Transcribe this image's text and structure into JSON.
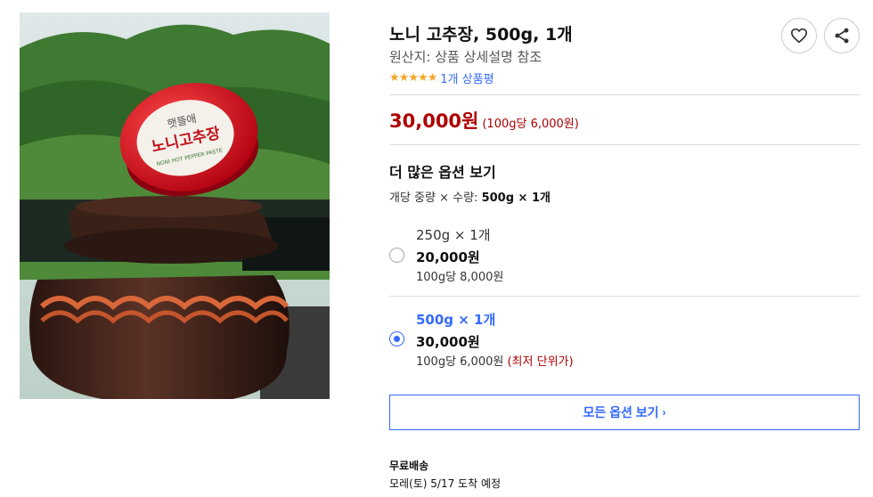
{
  "product": {
    "title": "노니 고추장, 500g, 1개",
    "origin": "원산지: 상품 상세설명 참조",
    "stars": "★★★★★",
    "review_count": "1개 상품평",
    "price": "30,000원",
    "unit_price": "(100g당 6,000원)"
  },
  "image": {
    "label_top": "햇뜰애",
    "label_main": "노니고추장",
    "label_sub": "NONI HOT PEPPER PASTE"
  },
  "icons": {
    "favorite": "heart-icon",
    "share": "share-icon"
  },
  "options": {
    "heading": "더 많은 옵션 보기",
    "qty_label": "개당 중량 × 수량:",
    "qty_value": "500g × 1개",
    "items": [
      {
        "name": "250g × 1개",
        "price": "20,000원",
        "unit": "100g당 8,000원",
        "badge": "",
        "selected": false
      },
      {
        "name": "500g × 1개",
        "price": "30,000원",
        "unit": "100g당 6,000원",
        "badge": "(최저 단위가)",
        "selected": true
      }
    ],
    "all_button": "모든 옵션 보기",
    "all_button_arrow": "›"
  },
  "shipping": {
    "title": "무료배송",
    "date": "모레(토) 5/17 도착 예정"
  },
  "colors": {
    "accent_blue": "#346aff",
    "price_red": "#ae0000",
    "star": "#f5a623"
  }
}
